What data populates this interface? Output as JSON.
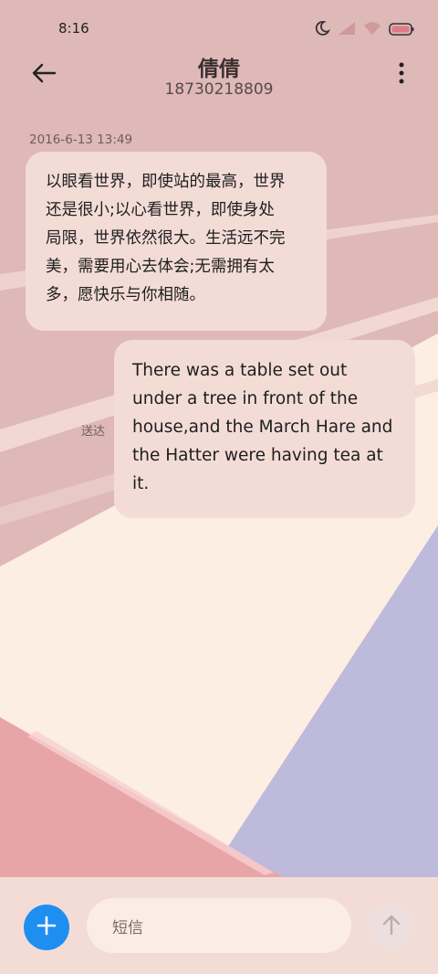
{
  "status_bar": {
    "time": "8:16",
    "icons": [
      "moon-icon",
      "cellular-signal-icon",
      "wifi-icon",
      "battery-icon"
    ]
  },
  "header": {
    "back_icon": "arrow-left-icon",
    "contact_name": "倩倩",
    "contact_number": "18730218809",
    "menu_icon": "more-vertical-icon"
  },
  "conversation": {
    "timestamp": "2016-6-13 13:49",
    "incoming_message": {
      "lines": [
        "以眼看世界，即使站的最高，世界",
        "还是很小;以心看世界，即使身处",
        "局限，世界依然很大。生活远不完",
        "美，需要用心去体会;无需拥有太",
        "多，愿快乐与你相随。"
      ]
    },
    "outgoing_message": {
      "lines": [
        "There was a table set out",
        "under a tree in front of the",
        "house,and the March Hare and",
        "the Hatter were having tea at",
        "it."
      ],
      "status": "送达"
    }
  },
  "composer": {
    "add_icon": "plus-icon",
    "placeholder": "短信",
    "send_icon": "arrow-up-icon"
  },
  "colors": {
    "accent": "#1e8ef1",
    "bubble": "#f3dcd6",
    "bg_pink": "#dfb8b8",
    "bg_cream": "#fdeee3",
    "bg_lavender": "#bebadb",
    "bg_rose": "#e8a5a8"
  }
}
